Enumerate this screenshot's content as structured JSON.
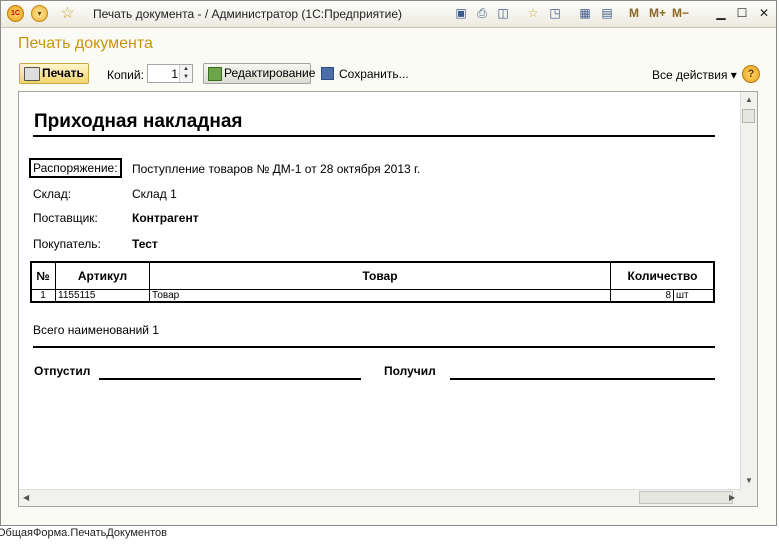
{
  "window": {
    "title": "Печать документа - / Администратор  (1С:Предприятие)",
    "logo_text": "1С",
    "right_tools": {
      "m": "M",
      "m_plus": "M+",
      "m_minus": "M−"
    },
    "controls": {
      "minimize": "▁",
      "maximize": "☐",
      "close": "✕"
    }
  },
  "form": {
    "title": "Печать документа",
    "toolbar": {
      "print_label": "Печать",
      "copies_label": "Копий:",
      "copies_value": "1",
      "edit_label": "Редактирование",
      "save_label": "Сохранить...",
      "all_actions_label": "Все действия ▾",
      "help_label": "?"
    }
  },
  "document": {
    "title": "Приходная накладная",
    "fields": [
      {
        "label": "Распоряжение:",
        "value": "Поступление товаров № ДМ-1 от 28 октября 2013 г."
      },
      {
        "label": "Склад:",
        "value": "Склад 1"
      },
      {
        "label": "Поставщик:",
        "value": "Контрагент"
      },
      {
        "label": "Покупатель:",
        "value": "Тест"
      }
    ],
    "table": {
      "headers": [
        "№",
        "Артикул",
        "Товар",
        "Количество"
      ],
      "rows": [
        {
          "num": "1",
          "article": "1155115",
          "product": "Товар",
          "qty": "8",
          "unit": "шт"
        }
      ]
    },
    "total_text": "Всего наименований 1",
    "released_label": "Отпустил",
    "received_label": "Получил"
  },
  "status_bar": {
    "text": "ОбщаяФорма.ПечатьДокументов"
  },
  "colors": {
    "form_title": "#c8950c",
    "print_button": "#f0d36a",
    "window_bg": "#fbfbf6"
  }
}
